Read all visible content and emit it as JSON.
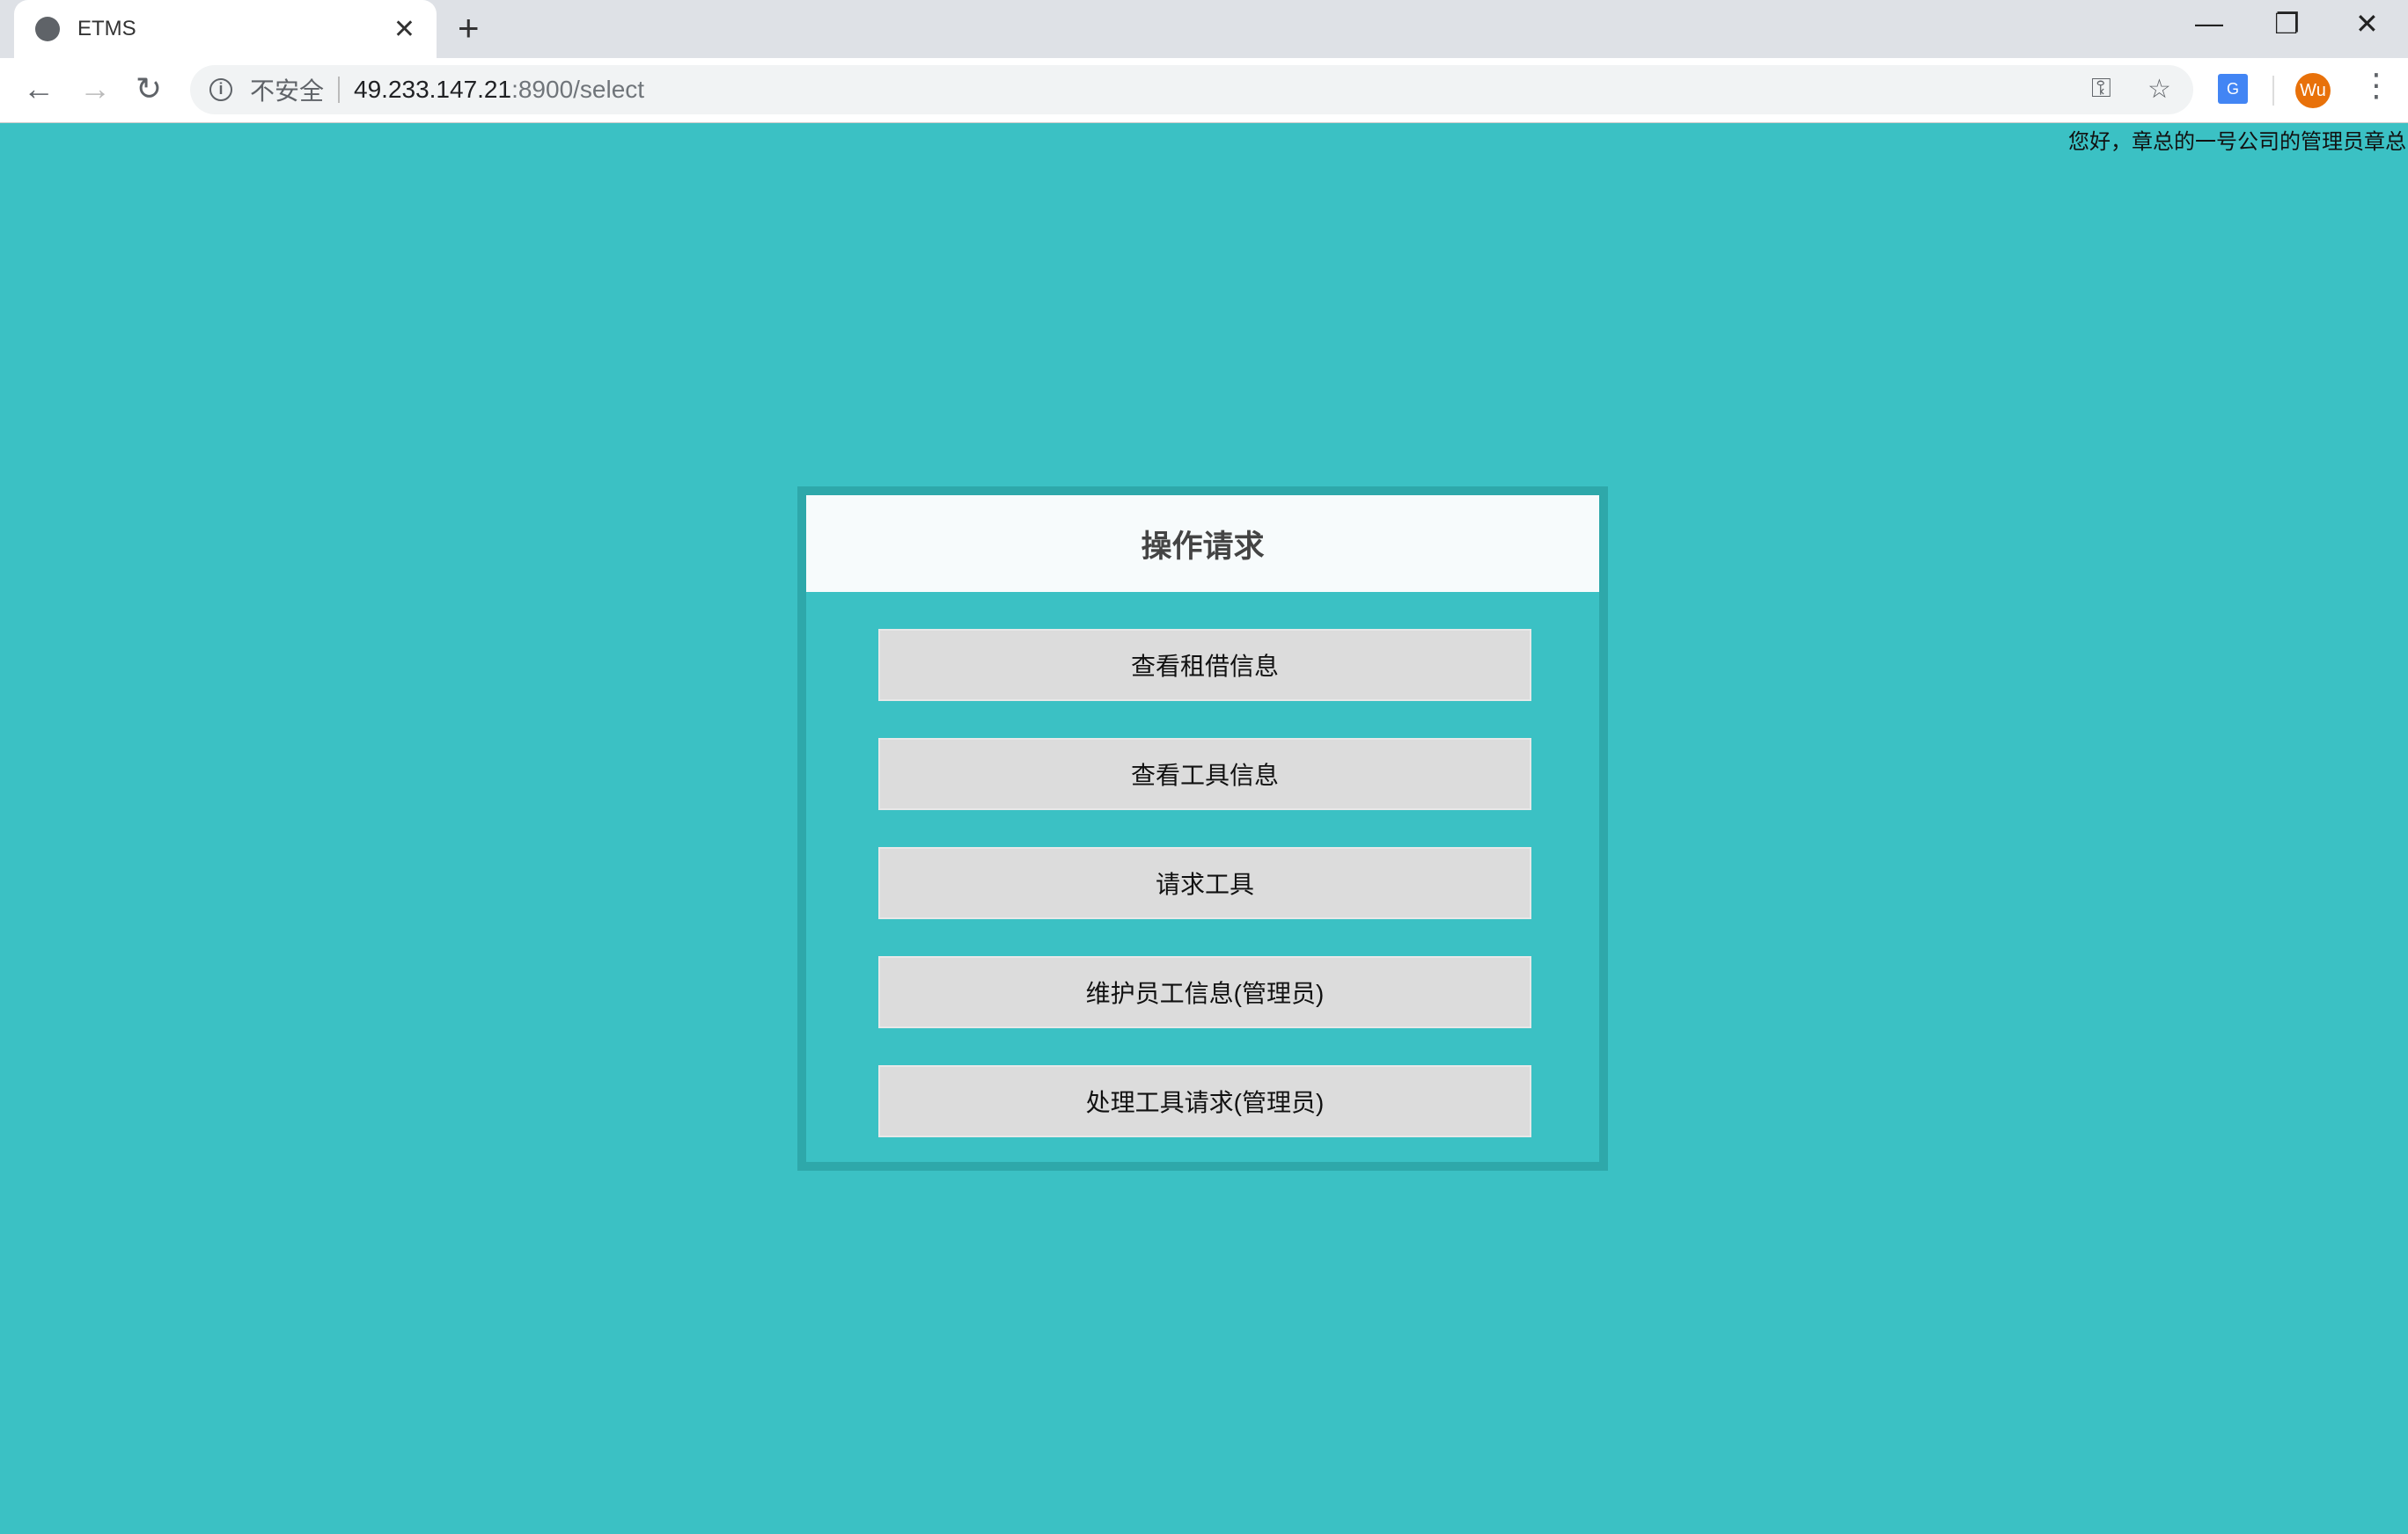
{
  "browser": {
    "tab_title": "ETMS",
    "url_security": "不安全",
    "url_host": "49.233.147.21",
    "url_path": ":8900/select",
    "profile_initials": "Wu",
    "translate_glyph": "G"
  },
  "page": {
    "greeting": "您好，章总的一号公司的管理员章总",
    "panel_title": "操作请求",
    "buttons": [
      "查看租借信息",
      "查看工具信息",
      "请求工具",
      "维护员工信息(管理员)",
      "处理工具请求(管理员)"
    ]
  },
  "colors": {
    "background": "#3bc1c4",
    "panel_border": "#2ea8aa",
    "button": "#dcdcdc"
  }
}
